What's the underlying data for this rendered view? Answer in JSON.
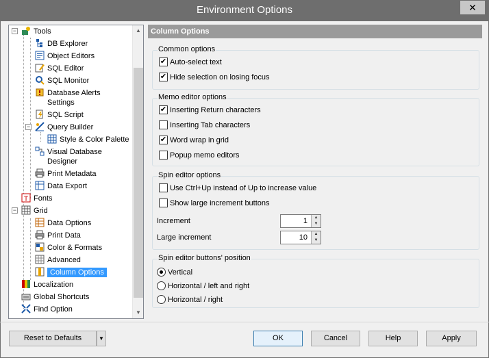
{
  "window": {
    "title": "Environment Options",
    "close_glyph": "✕"
  },
  "tree": {
    "items": [
      {
        "label": "Tools",
        "icon": "tools-icon"
      },
      {
        "label": "DB Explorer",
        "icon": "db-explorer-icon"
      },
      {
        "label": "Object Editors",
        "icon": "object-editors-icon"
      },
      {
        "label": "SQL Editor",
        "icon": "sql-editor-icon"
      },
      {
        "label": "SQL Monitor",
        "icon": "sql-monitor-icon"
      },
      {
        "label": "Database Alerts",
        "label2": "Settings",
        "icon": "database-alerts-icon"
      },
      {
        "label": "SQL Script",
        "icon": "sql-script-icon"
      },
      {
        "label": "Query Builder",
        "icon": "query-builder-icon"
      },
      {
        "label": "Style & Color Palette",
        "icon": "palette-icon"
      },
      {
        "label": "Visual Database",
        "label2": "Designer",
        "icon": "visual-designer-icon"
      },
      {
        "label": "Print Metadata",
        "icon": "printer-icon"
      },
      {
        "label": "Data Export",
        "icon": "data-export-icon"
      },
      {
        "label": "Fonts",
        "icon": "fonts-icon"
      },
      {
        "label": "Grid",
        "icon": "grid-icon"
      },
      {
        "label": "Data Options",
        "icon": "data-options-icon"
      },
      {
        "label": "Print Data",
        "icon": "printer-icon"
      },
      {
        "label": "Color & Formats",
        "icon": "color-formats-icon"
      },
      {
        "label": "Advanced",
        "icon": "advanced-icon"
      },
      {
        "label": "Column Options",
        "icon": "column-options-icon"
      },
      {
        "label": "Localization",
        "icon": "localization-icon"
      },
      {
        "label": "Global Shortcuts",
        "icon": "keyboard-icon"
      },
      {
        "label": "Find Option",
        "icon": "find-option-icon"
      }
    ]
  },
  "panel": {
    "title": "Column Options",
    "common": {
      "title": "Common options",
      "auto_select": {
        "label": "Auto-select text",
        "checked": true
      },
      "hide_selection": {
        "label": "Hide selection on losing focus",
        "checked": true
      }
    },
    "memo": {
      "title": "Memo editor options",
      "return_chars": {
        "label": "Inserting Return characters",
        "checked": true
      },
      "tab_chars": {
        "label": "Inserting Tab characters",
        "checked": false
      },
      "word_wrap": {
        "label": "Word wrap in grid",
        "checked": true
      },
      "popup": {
        "label": "Popup memo editors",
        "checked": false
      }
    },
    "spin": {
      "title": "Spin editor options",
      "ctrl_up": {
        "label": "Use Ctrl+Up instead of Up to increase value",
        "checked": false
      },
      "large_buttons": {
        "label": "Show large increment buttons",
        "checked": false
      },
      "increment_label": "Increment",
      "increment_value": "1",
      "large_increment_label": "Large increment",
      "large_increment_value": "10"
    },
    "position": {
      "title": "Spin editor buttons' position",
      "vertical": "Vertical",
      "horizontal_left_right": "Horizontal / left and right",
      "horizontal_right": "Horizontal / right",
      "selected": "Vertical"
    }
  },
  "buttons": {
    "reset": "Reset to Defaults",
    "ok": "OK",
    "cancel": "Cancel",
    "help": "Help",
    "apply": "Apply"
  },
  "colors": {
    "selection": "#3399ff",
    "header": "#9a9a9a",
    "titlebar": "#6e6e6e"
  }
}
